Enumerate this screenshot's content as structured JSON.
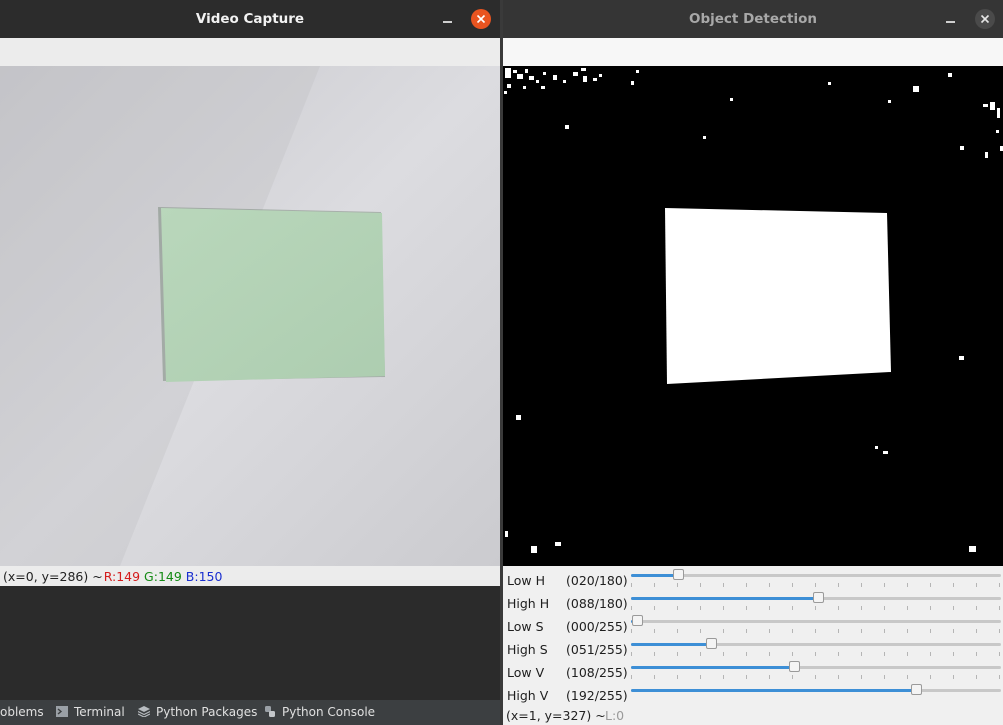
{
  "video_window": {
    "title": "Video Capture",
    "status": {
      "coords": "(x=0, y=286) ~",
      "r": "R:149",
      "g": "G:149",
      "b": "B:150"
    }
  },
  "detection_window": {
    "title": "Object Detection",
    "status": {
      "coords": "(x=1, y=327) ~",
      "level": "L:0"
    },
    "trackbars": [
      {
        "name": "Low H",
        "value": "(020/180)",
        "fraction": 0.111
      },
      {
        "name": "High H",
        "value": "(088/180)",
        "fraction": 0.489
      },
      {
        "name": "Low S",
        "value": "(000/255)",
        "fraction": 0.0
      },
      {
        "name": "High S",
        "value": "(051/255)",
        "fraction": 0.2
      },
      {
        "name": "Low V",
        "value": "(108/255)",
        "fraction": 0.424
      },
      {
        "name": "High V",
        "value": "(192/255)",
        "fraction": 0.753
      }
    ]
  },
  "ide_tool_tabs": [
    {
      "label": "oblems",
      "icon": "problems-icon"
    },
    {
      "label": "Terminal",
      "icon": "terminal-icon"
    },
    {
      "label": "Python Packages",
      "icon": "packages-icon"
    },
    {
      "label": "Python Console",
      "icon": "python-console-icon"
    }
  ],
  "colors": {
    "close_active": "#e95420",
    "slider_fill": "#3d8fd6",
    "paper_green": "#b7d4b9"
  }
}
